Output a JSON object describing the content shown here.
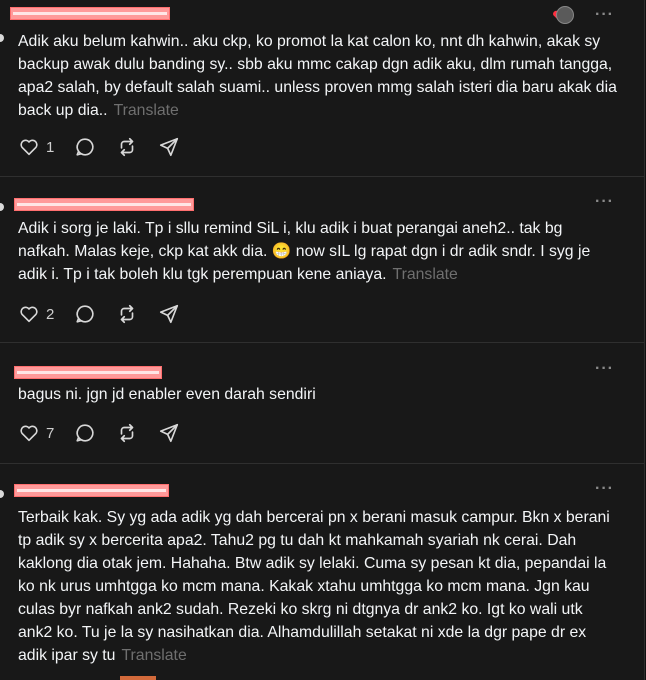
{
  "posts": [
    {
      "text": "Adik aku belum kahwin.. aku ckp, ko promot la kat calon ko, nnt dh kahwin, akak sy backup awak dulu banding sy.. sbb aku mmc cakap dgn adik aku, dlm rumah tangga, apa2 salah, by default salah suami.. unless proven mmg salah isteri dia baru akak dia back up dia..",
      "translate": "Translate",
      "likes": "1"
    },
    {
      "text": "Adik i sorg je laki. Tp i sllu remind SiL i, klu adik i buat perangai aneh2.. tak bg nafkah. Malas keje, ckp kat akk dia. 😁 now sIL lg rapat dgn i dr adik sndr. I syg je adik i. Tp i tak boleh klu tgk perempuan kene aniaya.",
      "translate": "Translate",
      "likes": "2"
    },
    {
      "text": "bagus ni. jgn jd enabler even darah sendiri",
      "translate": "",
      "likes": "7"
    },
    {
      "text": "Terbaik kak. Sy yg ada adik yg dah bercerai pn x berani masuk campur. Bkn x berani tp adik sy x bercerita apa2. Tahu2 pg tu dah kt mahkamah syariah nk cerai. Dah kaklong dia otak jem. Hahaha. Btw adik sy lelaki. Cuma sy pesan kt dia, pepandai la ko nk urus umhtgga ko mcm mana. Kakak xtahu umhtgga ko mcm mana. Jgn kau culas byr nafkah ank2 sudah. Rezeki ko skrg ni dtgnya dr ank2 ko. Igt ko wali utk ank2 ko. Tu je la sy nasihatkan dia. Alhamdulillah setakat ni xde la dgr pape dr ex adik ipar sy tu",
      "translate": "Translate",
      "likes": ""
    }
  ],
  "icons": {
    "more": "more-options-icon",
    "like": "heart-icon",
    "reply": "reply-bubble-icon",
    "repost": "repost-icon",
    "share": "share-send-icon"
  },
  "colors": {
    "background": "#181818",
    "text": "#f3f5f7",
    "muted": "#6f6f6f",
    "redaction": "#ff9a9a",
    "like_red": "#ff3040"
  }
}
